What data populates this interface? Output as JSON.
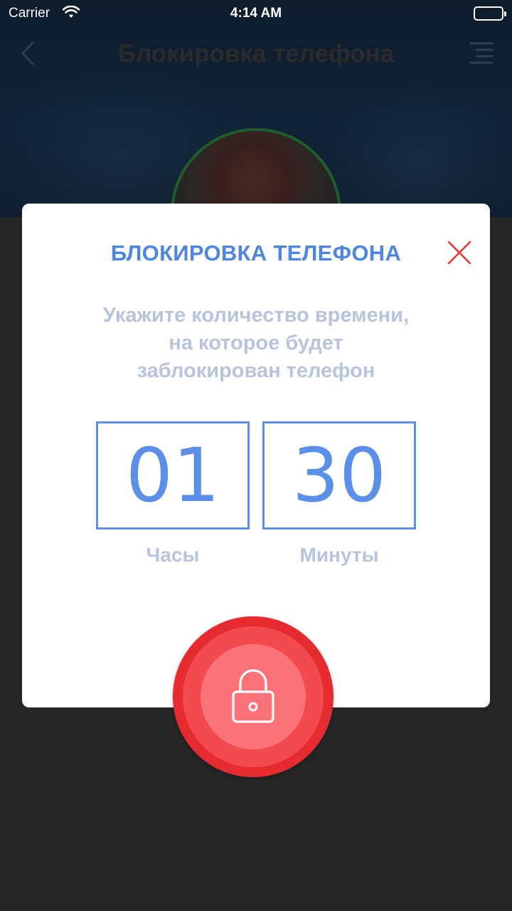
{
  "status_bar": {
    "carrier": "Carrier",
    "time": "4:14 AM"
  },
  "nav": {
    "title": "Блокировка телефона",
    "back_icon": "chevron-left-icon",
    "menu_icon": "menu-icon"
  },
  "dialog": {
    "title": "БЛОКИРОВКА ТЕЛЕФОНА",
    "subtitle_lines": [
      "Укажите количество времени,",
      "на которое будет",
      "заблокирован телефон"
    ],
    "hours_value": "01",
    "minutes_value": "30",
    "hours_label": "Часы",
    "minutes_label": "Минуты",
    "close_icon": "close-icon"
  },
  "lock_button": {
    "icon": "lock-icon"
  },
  "colors": {
    "accent_blue": "#5b8fe8",
    "muted_text": "#b8c3de",
    "close_red": "#e53935",
    "lock_red": "#e62b30",
    "overlay": "#262626"
  }
}
